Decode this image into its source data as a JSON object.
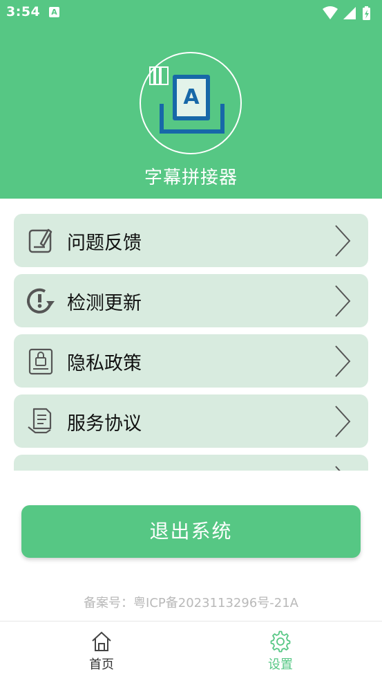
{
  "status_bar": {
    "time": "3:54",
    "notification_icon": "text-a-notification-icon",
    "wifi_icon": "wifi-icon",
    "signal_icon": "cell-signal-icon",
    "battery_icon": "battery-charging-icon"
  },
  "header": {
    "app_title": "字幕拼接器",
    "logo_icon": "subtitle-letter-a-logo-icon",
    "background_color": "#56c784"
  },
  "menu": {
    "items": [
      {
        "label": "问题反馈",
        "icon": "feedback-edit-icon"
      },
      {
        "label": "检测更新",
        "icon": "update-check-icon"
      },
      {
        "label": "隐私政策",
        "icon": "privacy-lock-icon"
      },
      {
        "label": "服务协议",
        "icon": "service-agreement-icon"
      },
      {
        "label": "",
        "icon": ""
      }
    ],
    "item_background": "#d8ebdf"
  },
  "logout_button": {
    "label": "退出系统"
  },
  "footer": {
    "icp": "备案号：粤ICP备2023113296号-21A"
  },
  "bottom_nav": {
    "tabs": [
      {
        "label": "首页",
        "icon": "home-icon",
        "active": false
      },
      {
        "label": "设置",
        "icon": "settings-gear-icon",
        "active": true
      }
    ],
    "active_color": "#56c784"
  }
}
